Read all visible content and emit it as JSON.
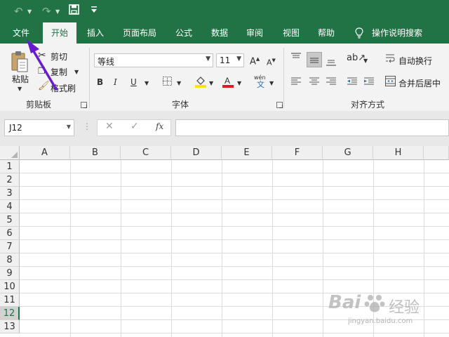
{
  "quick_access": {
    "undo_icon": "undo-icon",
    "redo_icon": "redo-icon",
    "save_icon": "save-icon",
    "customize_icon": "customize-icon"
  },
  "tabs": [
    "文件",
    "开始",
    "插入",
    "页面布局",
    "公式",
    "数据",
    "审阅",
    "视图",
    "帮助"
  ],
  "tell_me": "操作说明搜索",
  "clipboard": {
    "paste": "粘贴",
    "cut": "剪切",
    "copy": "复制",
    "format_painter": "格式刷",
    "group": "剪贴板"
  },
  "font": {
    "name": "等线",
    "size": "11",
    "group": "字体",
    "bold": "B",
    "italic": "I",
    "underline": "U",
    "phonetic": "wén",
    "phonetic_char": "文"
  },
  "alignment": {
    "wrap": "自动换行",
    "merge": "合并后居中",
    "group": "对齐方式"
  },
  "name_box": "J12",
  "fx": "fx",
  "columns": [
    "A",
    "B",
    "C",
    "D",
    "E",
    "F",
    "G",
    "H"
  ],
  "rows": [
    "1",
    "2",
    "3",
    "4",
    "5",
    "6",
    "7",
    "8",
    "9",
    "10",
    "11",
    "12",
    "13"
  ],
  "selected_row": "12",
  "watermark": {
    "brand_left": "Bai",
    "brand_right": "经验",
    "url": "jingyan.baidu.com"
  },
  "colors": {
    "excel_green": "#217346",
    "annotation_arrow": "#6a1bd1"
  }
}
